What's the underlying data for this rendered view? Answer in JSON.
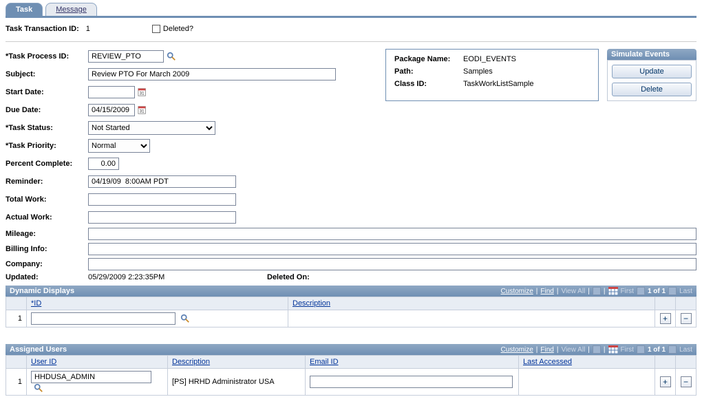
{
  "tabs": {
    "task": "Task",
    "message": "Message"
  },
  "deleted_label": "Deleted?",
  "txn_id_label": "Task Transaction ID:",
  "txn_id_value": "1",
  "labels": {
    "task_process_id": "*Task Process ID:",
    "subject": "Subject:",
    "start_date": "Start Date:",
    "due_date": "Due Date:",
    "task_status": "*Task Status:",
    "task_priority": "*Task Priority:",
    "percent_complete": "Percent Complete:",
    "reminder": "Reminder:",
    "total_work": "Total Work:",
    "actual_work": "Actual Work:",
    "mileage": "Mileage:",
    "billing_info": "Billing Info:",
    "company": "Company:",
    "updated": "Updated:",
    "deleted_on": "Deleted On:"
  },
  "values": {
    "task_process_id": "REVIEW_PTO",
    "subject": "Review PTO For March 2009",
    "start_date": "",
    "due_date": "04/15/2009",
    "task_status": "Not Started",
    "task_priority": "Normal",
    "percent_complete": "0.00",
    "reminder": "04/19/09  8:00AM PDT",
    "total_work": "",
    "actual_work": "",
    "mileage": "",
    "billing_info": "",
    "company": "",
    "updated": "05/29/2009  2:23:35PM",
    "deleted_on": ""
  },
  "package_box": {
    "package_name_lbl": "Package Name:",
    "package_name_val": "EODI_EVENTS",
    "path_lbl": "Path:",
    "path_val": "Samples",
    "class_id_lbl": "Class ID:",
    "class_id_val": "TaskWorkListSample"
  },
  "simulate": {
    "title": "Simulate Events",
    "update": "Update",
    "delete": "Delete"
  },
  "grid_tools": {
    "customize": "Customize",
    "find": "Find",
    "view_all": "View All",
    "first": "First",
    "range": "1 of 1",
    "last": "Last"
  },
  "dynamic_displays": {
    "title": "Dynamic Displays",
    "cols": {
      "id": "*ID",
      "description": "Description"
    },
    "rows": [
      {
        "num": "1",
        "id": "",
        "description": ""
      }
    ]
  },
  "assigned_users": {
    "title": "Assigned Users",
    "cols": {
      "user_id": "User ID",
      "description": "Description",
      "email_id": "Email ID",
      "last_accessed": "Last Accessed"
    },
    "rows": [
      {
        "num": "1",
        "user_id": "HHDUSA_ADMIN",
        "description": "[PS] HRHD Administrator USA",
        "email_id": "",
        "last_accessed": ""
      }
    ]
  }
}
